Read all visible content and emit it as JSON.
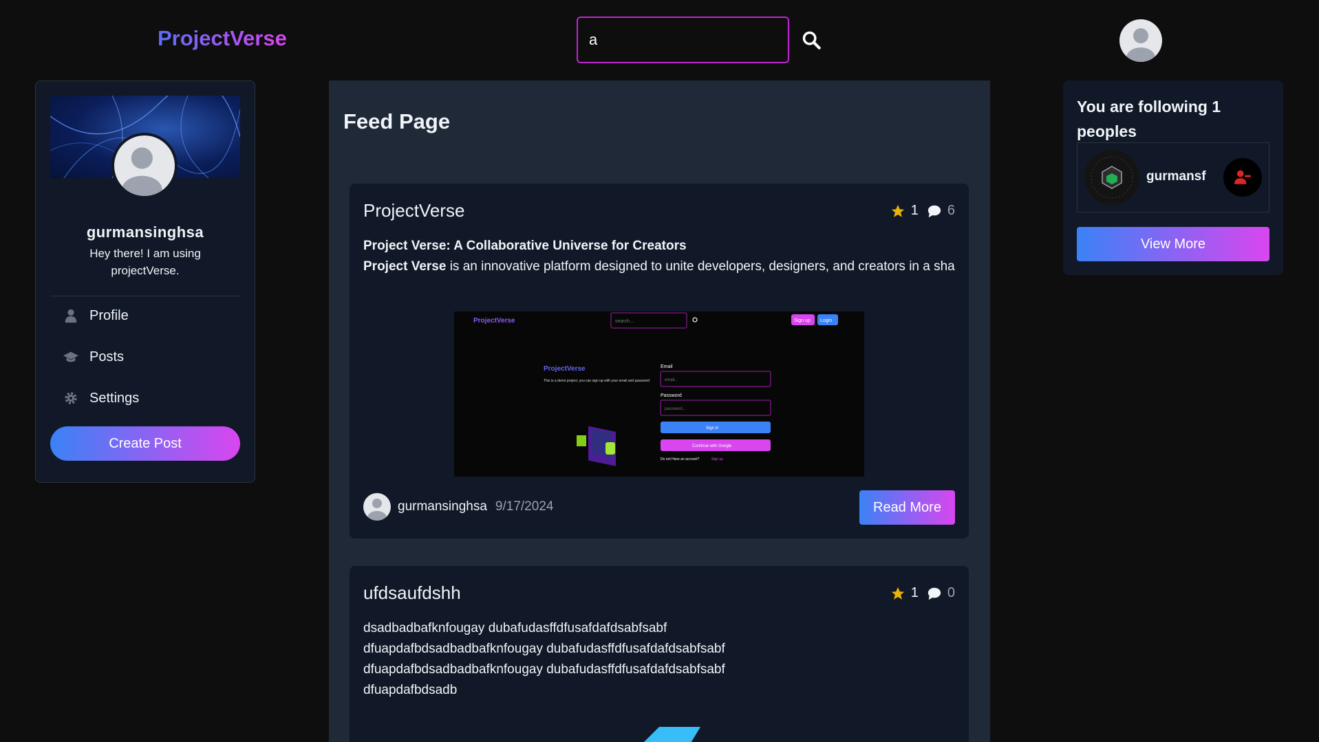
{
  "header": {
    "logo": "ProjectVerse",
    "search_value": "a",
    "search_icon": "search-icon",
    "avatar_icon": "user-avatar-icon"
  },
  "profile": {
    "username": "gurmansinghsa",
    "bio": "Hey there! I am using projectVerse.",
    "nav": [
      {
        "label": "Profile",
        "icon": "user-icon"
      },
      {
        "label": "Posts",
        "icon": "graduation-cap-icon"
      },
      {
        "label": "Settings",
        "icon": "gear-icon"
      }
    ],
    "create_label": "Create Post"
  },
  "feed": {
    "title": "Feed Page",
    "posts": [
      {
        "title": "ProjectVerse",
        "stars": "1",
        "comments": "6",
        "heading": "Project Verse: A Collaborative Universe for Creators",
        "body_bold": "Project Verse",
        "body_rest": " is an innovative platform designed to unite developers, designers, and creators in a sha",
        "author": "gurmansinghsa",
        "date": "9/17/2024",
        "read_more": "Read More",
        "thumbnail": {
          "logo": "ProjectVerse",
          "search_placeholder": "search...",
          "signup": "Sign up",
          "login": "Login",
          "brand": "ProjectVerse",
          "desc": "This is a demo project, you can sign up with your email and password",
          "email_label": "Email",
          "email_placeholder": "email...",
          "password_label": "Password",
          "password_placeholder": "password...",
          "signin": "Sign in",
          "google": "Continue with Google",
          "no_account": "Do not Have an account?",
          "signup_link": "Sign up"
        }
      },
      {
        "title": "ufdsaufdshh",
        "stars": "1",
        "comments": "0",
        "lines": [
          "dsadbadbafknfougay dubafudasffdfusafdafdsabfsabf",
          "dfuapdafbdsadbadbafknfougay dubafudasffdfusafdafdsabfsabf",
          "dfuapdafbdsadbadbafknfougay dubafudasffdfusafdafdsabfsabf",
          "dfuapdafbdsadb"
        ]
      }
    ]
  },
  "following": {
    "title": "You are following 1 peoples",
    "people": [
      {
        "name": "gurmansf"
      }
    ],
    "view_more": "View More"
  },
  "colors": {
    "accent_start": "#3b82f6",
    "accent_end": "#d946ef",
    "star": "#eab308",
    "unfollow": "#dc2626"
  }
}
